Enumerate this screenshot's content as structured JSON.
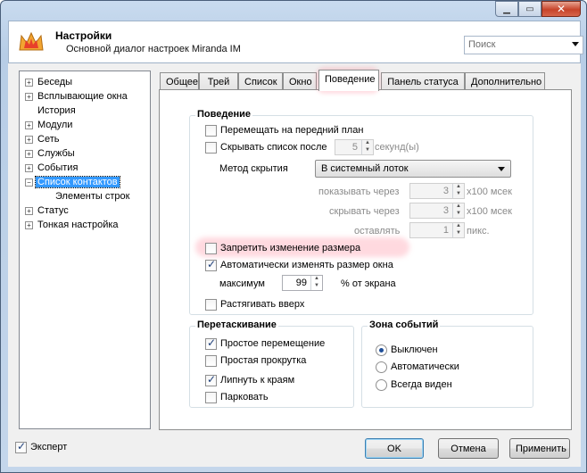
{
  "header": {
    "title": "Настройки",
    "subtitle": "Основной диалог настроек Miranda IM",
    "search_placeholder": "Поиск"
  },
  "titlebar": {
    "minimize": "▁",
    "maximize": "▭",
    "close": "✕"
  },
  "tree": {
    "items": [
      {
        "label": "Беседы",
        "expander": "+"
      },
      {
        "label": "Всплывающие окна",
        "expander": "+"
      },
      {
        "label": "История",
        "expander": ""
      },
      {
        "label": "Модули",
        "expander": "+"
      },
      {
        "label": "Сеть",
        "expander": "+"
      },
      {
        "label": "Службы",
        "expander": "+"
      },
      {
        "label": "События",
        "expander": "+"
      },
      {
        "label": "Список контактов",
        "expander": "−",
        "selected": true
      },
      {
        "label": "Элементы строк",
        "expander": ""
      },
      {
        "label": "Статус",
        "expander": "+"
      },
      {
        "label": "Тонкая настройка",
        "expander": "+"
      }
    ]
  },
  "tabs": [
    {
      "label": "Общее"
    },
    {
      "label": "Трей"
    },
    {
      "label": "Список"
    },
    {
      "label": "Окно"
    },
    {
      "label": "Поведение",
      "active": true
    },
    {
      "label": "Панель статуса"
    },
    {
      "label": "Дополнительно"
    }
  ],
  "behavior": {
    "title": "Поведение",
    "bring_to_front": {
      "label": "Перемещать на передний план",
      "checked": false
    },
    "hide_after": {
      "label": "Скрывать список после",
      "checked": false,
      "value": "5",
      "unit": "секунд(ы)"
    },
    "hide_method": {
      "label": "Метод скрытия",
      "value": "В системный лоток"
    },
    "show_after": {
      "label": "показывать через",
      "value": "3",
      "unit": "x100 мсек"
    },
    "hide_delay": {
      "label": "скрывать через",
      "value": "3",
      "unit": "x100 мсек"
    },
    "leave": {
      "label": "оставлять",
      "value": "1",
      "unit": "пикс."
    },
    "no_resize": {
      "label": "Запретить изменение размера",
      "checked": false
    },
    "auto_resize": {
      "label": "Автоматически изменять размер окна",
      "checked": true
    },
    "max": {
      "label": "максимум",
      "value": "99",
      "unit": "% от экрана"
    },
    "stretch_up": {
      "label": "Растягивать вверх",
      "checked": false
    }
  },
  "drag": {
    "title": "Перетаскивание",
    "simple_move": {
      "label": "Простое перемещение",
      "checked": true
    },
    "simple_scroll": {
      "label": "Простая прокрутка",
      "checked": false
    },
    "snap_edges": {
      "label": "Липнуть к краям",
      "checked": true
    },
    "dock": {
      "label": "Парковать",
      "checked": false
    }
  },
  "events": {
    "title": "Зона событий",
    "off": {
      "label": "Выключен",
      "selected": true
    },
    "auto": {
      "label": "Автоматически",
      "selected": false
    },
    "always": {
      "label": "Всегда виден",
      "selected": false
    }
  },
  "footer": {
    "expert": {
      "label": "Эксперт",
      "checked": true
    },
    "ok": "OK",
    "cancel": "Отмена",
    "apply": "Применить"
  },
  "colors": {
    "highlight": "#ff7890",
    "selection": "#3399ff",
    "close_button": "#c7442a"
  }
}
